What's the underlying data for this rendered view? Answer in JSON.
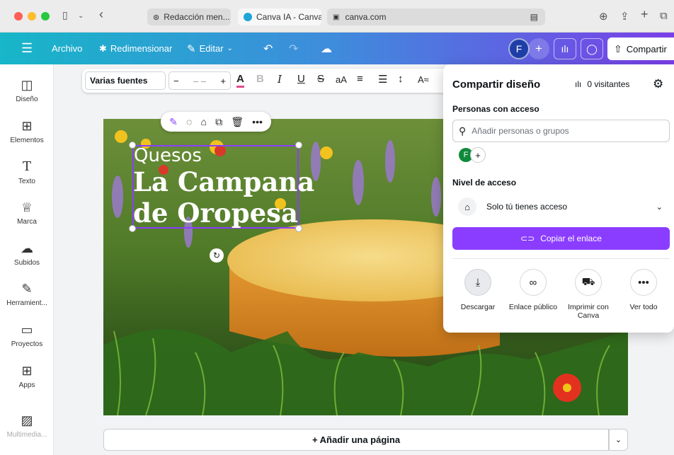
{
  "browser": {
    "tabs": [
      {
        "label": "Redacción men..."
      },
      {
        "label": "Canva IA - Canva"
      }
    ],
    "address": "canva.com"
  },
  "topbar": {
    "file": "Archivo",
    "resize": "Redimensionar",
    "edit": "Editar",
    "avatar_initial": "F",
    "share": "Compartir"
  },
  "sidebar": {
    "items": [
      {
        "label": "Diseño",
        "icon": "design-icon"
      },
      {
        "label": "Elementos",
        "icon": "elements-icon"
      },
      {
        "label": "Texto",
        "icon": "text-icon"
      },
      {
        "label": "Marca",
        "icon": "brand-icon"
      },
      {
        "label": "Subidos",
        "icon": "uploads-icon"
      },
      {
        "label": "Herramient...",
        "icon": "tools-icon"
      },
      {
        "label": "Proyectos",
        "icon": "projects-icon"
      },
      {
        "label": "Apps",
        "icon": "apps-icon"
      },
      {
        "label": "Multimedia...",
        "icon": "media-icon"
      }
    ]
  },
  "toolbar": {
    "font": "Varias fuentes",
    "size_minus": "−",
    "size_value": "– –",
    "size_plus": "+"
  },
  "design": {
    "subtitle": "Quesos",
    "title_line1": "La Campana",
    "title_line2": "de Oropesa"
  },
  "add_page": "+ Añadir una página",
  "share_panel": {
    "title": "Compartir diseño",
    "visitors": "0 visitantes",
    "people_label": "Personas con acceso",
    "search_placeholder": "Añadir personas o grupos",
    "person_initial": "F",
    "access_label": "Nivel de acceso",
    "access_value": "Solo tú tienes acceso",
    "copy_link": "Copiar el enlace",
    "actions": [
      {
        "label": "Descargar",
        "icon": "download-icon"
      },
      {
        "label": "Enlace público",
        "icon": "link-icon"
      },
      {
        "label": "Imprimir con Canva",
        "icon": "truck-icon"
      },
      {
        "label": "Ver todo",
        "icon": "more-icon"
      }
    ]
  },
  "colors": {
    "accent": "#8b3dff",
    "topbar_start": "#17b6c8",
    "topbar_end": "#7b3fe8"
  }
}
